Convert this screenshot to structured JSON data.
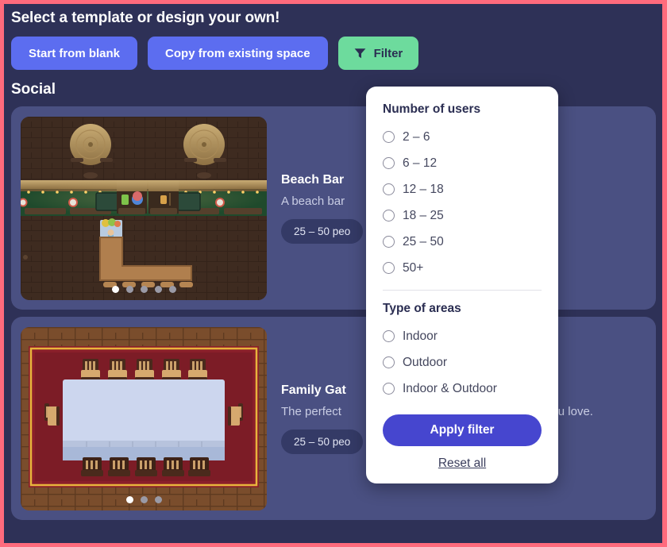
{
  "header": {
    "title": "Select a template or design your own!",
    "buttons": {
      "start_blank": "Start from blank",
      "copy_existing": "Copy from existing space",
      "filter": "Filter",
      "filter_icon": "funnel-icon"
    }
  },
  "section": {
    "title": "Social"
  },
  "cards": [
    {
      "title": "Beach Bar",
      "description": "A beach bar",
      "badge": "25 – 50 peo",
      "dots": 5,
      "active_dot": 0,
      "art": "beach-bar-pixel-art"
    },
    {
      "title": "Family Gat",
      "description": "The perfect",
      "description_tail": "hose you love.",
      "badge": "25 – 50 peo",
      "dots": 3,
      "active_dot": 0,
      "art": "family-room-pixel-art"
    }
  ],
  "filter_panel": {
    "users_heading": "Number of users",
    "users_options": [
      "2 – 6",
      "6 – 12",
      "12 – 18",
      "18 – 25",
      "25 – 50",
      "50+"
    ],
    "areas_heading": "Type of areas",
    "areas_options": [
      "Indoor",
      "Outdoor",
      "Indoor & Outdoor"
    ],
    "apply_label": "Apply filter",
    "reset_label": "Reset all"
  },
  "colors": {
    "page_border": "#ff6b7d",
    "background": "#2e3157",
    "card": "#4a5082",
    "badge": "#343a66",
    "button_blue": "#5c6df0",
    "filter_green": "#6ddb9d",
    "apply_indigo": "#4646cf"
  }
}
